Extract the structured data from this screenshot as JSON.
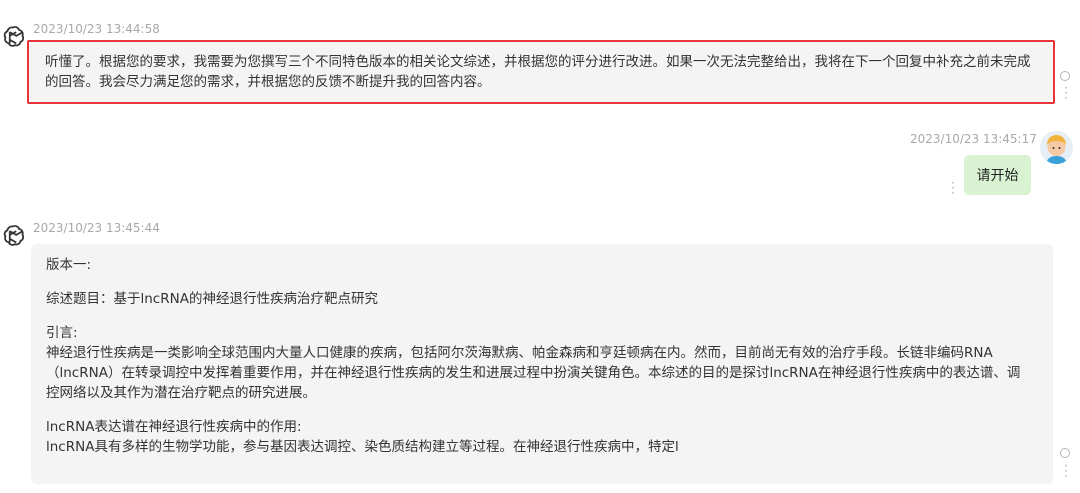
{
  "messages": {
    "m1": {
      "timestamp": "2023/10/23 13:44:58",
      "text": "听懂了。根据您的要求，我需要为您撰写三个不同特色版本的相关论文综述，并根据您的评分进行改进。如果一次无法完整给出，我将在下一个回复中补充之前未完成的回答。我会尽力满足您的需求，并根据您的反馈不断提升我的回答内容。"
    },
    "m2": {
      "timestamp": "2023/10/23 13:45:17",
      "text": "请开始"
    },
    "m3": {
      "timestamp": "2023/10/23 13:45:44",
      "version": "版本一:",
      "topic": "综述题目：基于lncRNA的神经退行性疾病治疗靶点研究",
      "intro_heading": "引言:",
      "intro_text": "神经退行性疾病是一类影响全球范围内大量人口健康的疾病，包括阿尔茨海默病、帕金森病和亨廷顿病在内。然而，目前尚无有效的治疗手段。长链非编码RNA（lncRNA）在转录调控中发挥着重要作用，并在神经退行性疾病的发生和进展过程中扮演关键角色。本综述的目的是探讨lncRNA在神经退行性疾病中的表达谱、调控网络以及其作为潜在治疗靶点的研究进展。",
      "section_heading": "lncRNA表达谱在神经退行性疾病中的作用:",
      "section_text": "lncRNA具有多样的生物学功能，参与基因表达调控、染色质结构建立等过程。在神经退行性疾病中，特定l"
    }
  },
  "colors": {
    "highlight_border": "#e8343a",
    "user_bubble": "#d9f3d2",
    "bot_bubble": "#f4f4f5"
  },
  "icons": {
    "bot": "openai-logo-icon",
    "user": "user-avatar-icon"
  }
}
